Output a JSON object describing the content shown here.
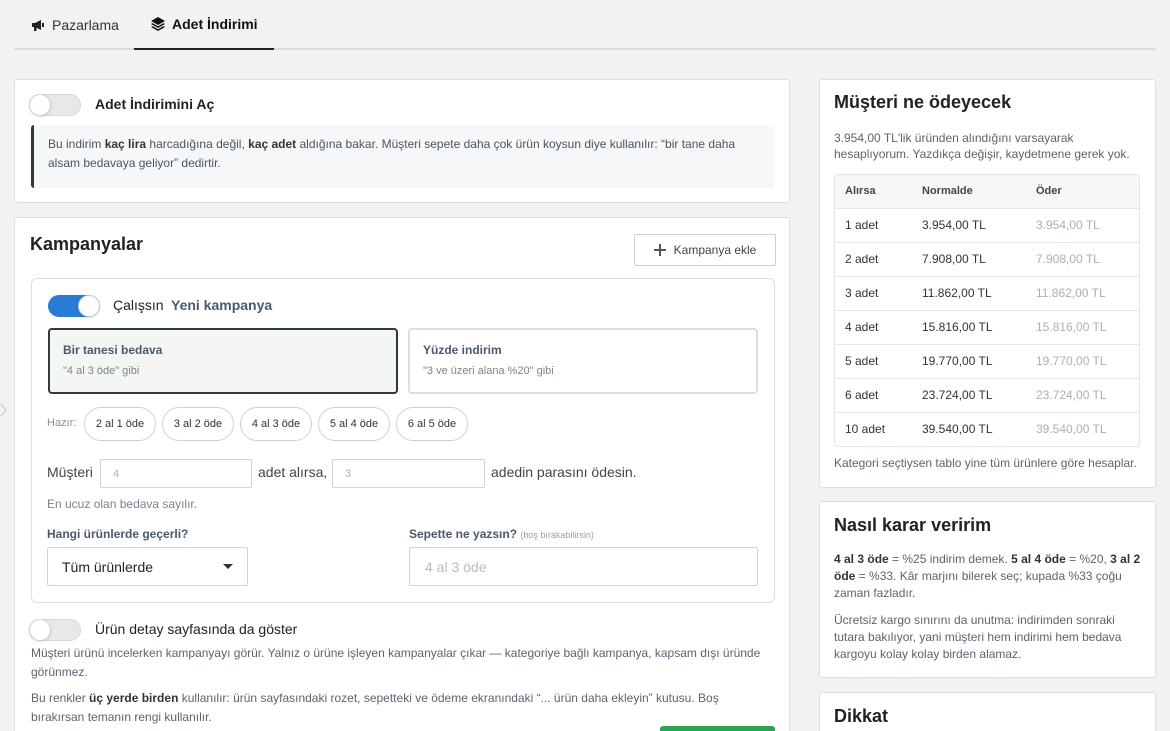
{
  "tabs": [
    {
      "label": "Pazarlama",
      "icon": "megaphone-icon",
      "active": false
    },
    {
      "label": "Adet İndirimi",
      "icon": "layers-icon",
      "active": true
    }
  ],
  "toggle_section": {
    "title": "Adet İndirimini Aç",
    "enabled": false,
    "note_parts": [
      "Bu indirim ",
      "kaç lira",
      " harcadığına değil, ",
      "kaç adet",
      " aldığına bakar. Müşteri sepete daha çok ürün koysun diye kullanılır: “bir tane daha alsam bedavaya geliyor” dedirtir."
    ]
  },
  "campaigns": {
    "title": "Kampanyalar",
    "add_button": "Kampanya ekle",
    "campaign": {
      "status_label": "Çalışsın",
      "name": "Yeni kampanya",
      "enabled": true,
      "types": [
        {
          "title": "Bir tanesi bedava",
          "subtitle": "\"4 al 3 öde\" gibi",
          "selected": true
        },
        {
          "title": "Yüzde indirim",
          "subtitle": "\"3 ve üzeri alana %20\" gibi",
          "selected": false
        }
      ],
      "presets_label": "Hazır:",
      "presets": [
        "2 al 1 öde",
        "3 al 2 öde",
        "4 al 3 öde",
        "5 al 4 öde",
        "6 al 5 öde"
      ],
      "sentence": {
        "prefix": "Müşteri",
        "buy_placeholder": "4",
        "middle": "adet alırsa,",
        "pay_placeholder": "3",
        "suffix": "adedin parasını ödesin."
      },
      "cheapest_note": "En ucuz olan bedava sayılır.",
      "scope_label": "Hangi ürünlerde geçerli?",
      "scope_value": "Tüm ürünlerde",
      "cart_label": "Sepette ne yazsın?",
      "cart_hint": "(boş bırakabilirsin)",
      "cart_placeholder": "4 al 3 öde"
    },
    "product_detail": {
      "label": "Ürün detay sayfasında da göster",
      "enabled": false,
      "description": "Müşteri ürünü incelerken kampanyayı görür. Yalnız o ürüne işleyen kampanyalar çıkar — kategoriye bağlı kampanya, kapsam dışı üründe görünmez.",
      "colors_parts": [
        "Bu renkler ",
        "üç yerde birden",
        " kullanılır: ürün sayfasındaki rozet, sepetteki ve ödeme ekranındaki “... ürün daha ekleyin” kutusu. Boş bırakırsan temanın rengi kullanılır."
      ]
    }
  },
  "payment_panel": {
    "title": "Müşteri ne ödeyecek",
    "intro": "3.954,00 TL'lik üründen alındığını varsayarak hesaplıyorum. Yazdıkça değişir, kaydetmene gerek yok.",
    "headers": [
      "Alırsa",
      "Normalde",
      "Öder"
    ],
    "rows": [
      [
        "1 adet",
        "3.954,00 TL",
        "3.954,00 TL"
      ],
      [
        "2 adet",
        "7.908,00 TL",
        "7.908,00 TL"
      ],
      [
        "3 adet",
        "11.862,00 TL",
        "11.862,00 TL"
      ],
      [
        "4 adet",
        "15.816,00 TL",
        "15.816,00 TL"
      ],
      [
        "5 adet",
        "19.770,00 TL",
        "19.770,00 TL"
      ],
      [
        "6 adet",
        "23.724,00 TL",
        "23.724,00 TL"
      ],
      [
        "10 adet",
        "39.540,00 TL",
        "39.540,00 TL"
      ]
    ],
    "footnote": "Kategori seçtiysen tablo yine tüm ürünlere göre hesaplar."
  },
  "decision_panel": {
    "title": "Nasıl karar veririm",
    "p1_parts": [
      "4 al 3 öde",
      " = %25 indirim demek. ",
      "5 al 4 öde",
      " = %20, ",
      "3 al 2 öde",
      " = %33. Kâr marjını bilerek seç; kupada %33 çoğu zaman fazladır."
    ],
    "p2": "Ücretsiz kargo sınırını da unutma: indirimden sonraki tutara bakılıyor, yani müşteri hem indirimi hem bedava kargoyu kolay kolay birden alamaz."
  },
  "warning_panel": {
    "title": "Dikkat"
  },
  "colors": {
    "accent": "#2a7ad8",
    "selected_border": "#2f3a3a",
    "save_green": "#2aa44f"
  }
}
